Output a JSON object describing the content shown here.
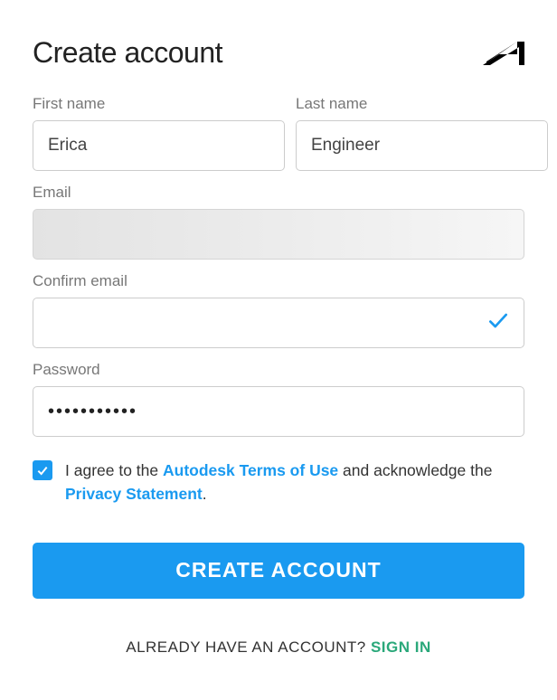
{
  "header": {
    "title": "Create account",
    "logo_name": "autodesk-logo"
  },
  "fields": {
    "first_name": {
      "label": "First name",
      "value": "Erica"
    },
    "last_name": {
      "label": "Last name",
      "value": "Engineer"
    },
    "email": {
      "label": "Email",
      "value": ""
    },
    "confirm_email": {
      "label": "Confirm email",
      "value": "",
      "valid": true
    },
    "password": {
      "label": "Password",
      "value": "•••••••••••"
    }
  },
  "consent": {
    "checked": true,
    "prefix": "I agree to the ",
    "terms_link": "Autodesk Terms of Use",
    "middle": " and acknowledge the ",
    "privacy_link": "Privacy Statement",
    "suffix": "."
  },
  "submit": {
    "label": "CREATE ACCOUNT"
  },
  "footer": {
    "text": "ALREADY HAVE AN ACCOUNT? ",
    "signin_label": "SIGN IN"
  },
  "colors": {
    "accent": "#1a9af0",
    "signin": "#2aa87a"
  }
}
